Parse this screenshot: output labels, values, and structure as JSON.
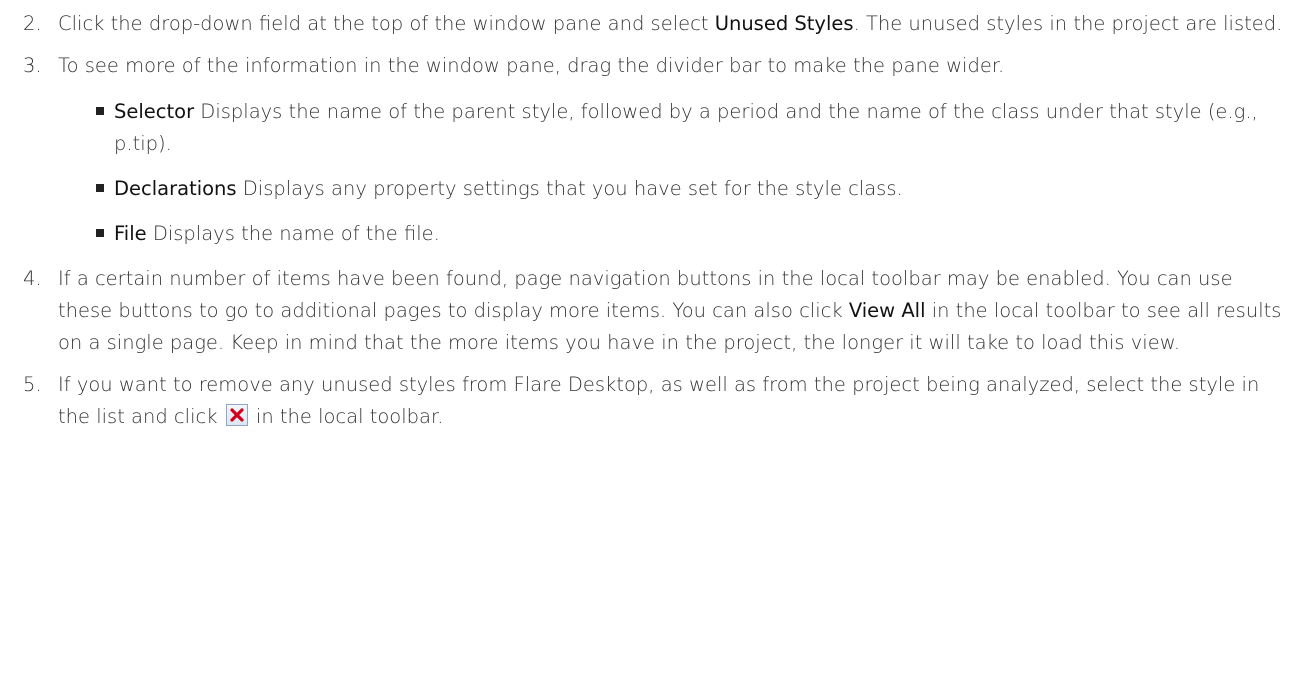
{
  "steps": [
    {
      "number": "2.",
      "segments": [
        "Click the drop-down field at the top of the window pane and select ",
        "Unused Styles",
        ". The unused styles in the project are listed."
      ]
    },
    {
      "number": "3.",
      "text": "To see more of the information in the window pane, drag the divider bar to make the pane wider.",
      "bullets": [
        {
          "term": "Selector",
          "text": " Displays the name of the parent style, followed by a period and the name of the class under that style (e.g., p.tip)."
        },
        {
          "term": "Declarations",
          "text": " Displays any property settings that you have set for the style class."
        },
        {
          "term": "File",
          "text": " Displays the name of the file."
        }
      ]
    },
    {
      "number": "4.",
      "segments": [
        "If a certain number of items have been found, page navigation buttons in the local toolbar may be enabled. You can use these buttons to go to additional pages to display more items. You can also click ",
        "View All",
        " in the local toolbar to see all results on a single page. Keep in mind that the more items you have in the project, the longer it will take to load this view."
      ]
    },
    {
      "number": "5.",
      "segments": [
        "If you want to remove any unused styles from Flare Desktop, as well as from the project being analyzed, select the style in the list and click ",
        " in the local toolbar."
      ],
      "icon": "delete-icon"
    }
  ],
  "colors": {
    "text": "#333333",
    "emphasis": "#111111",
    "delete_icon_x": "#d0021b"
  }
}
